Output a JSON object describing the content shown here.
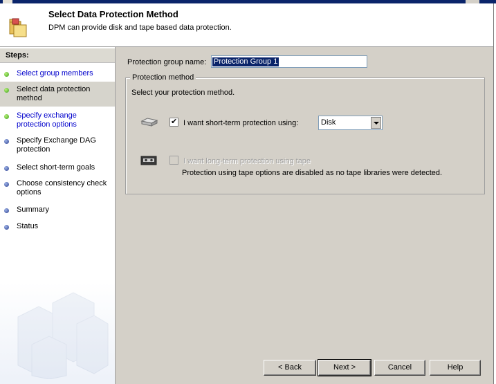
{
  "header": {
    "title": "Select Data Protection Method",
    "subtitle": "DPM can provide disk and tape based data protection."
  },
  "sidebar": {
    "heading": "Steps:",
    "steps": [
      {
        "label": "Select group members",
        "state": "done"
      },
      {
        "label": "Select data protection method",
        "state": "current"
      },
      {
        "label": "Specify exchange protection options",
        "state": "link"
      },
      {
        "label": "Specify Exchange DAG protection",
        "state": "pending"
      },
      {
        "label": "Select short-term goals",
        "state": "pending"
      },
      {
        "label": "Choose consistency check options",
        "state": "pending"
      },
      {
        "label": "Summary",
        "state": "pending"
      },
      {
        "label": "Status",
        "state": "pending"
      }
    ]
  },
  "form": {
    "group_name_label": "Protection group name:",
    "group_name_value": "Protection Group 1",
    "method_group_title": "Protection method",
    "method_instruction": "Select your protection method.",
    "short_term": {
      "label": "I want short-term protection using:",
      "checked": true,
      "selected": "Disk"
    },
    "long_term": {
      "label": "I want long-term protection using tape",
      "checked": false,
      "enabled": false
    },
    "tape_note": "Protection using tape options are disabled as no tape libraries were detected."
  },
  "buttons": {
    "back": "< Back",
    "next": "Next >",
    "cancel": "Cancel",
    "help": "Help"
  },
  "colors": {
    "done_dot": "#3ca21c",
    "pending_dot": "#2a3f8f",
    "link_text": "#0000cc",
    "selection": "#0a246a"
  }
}
